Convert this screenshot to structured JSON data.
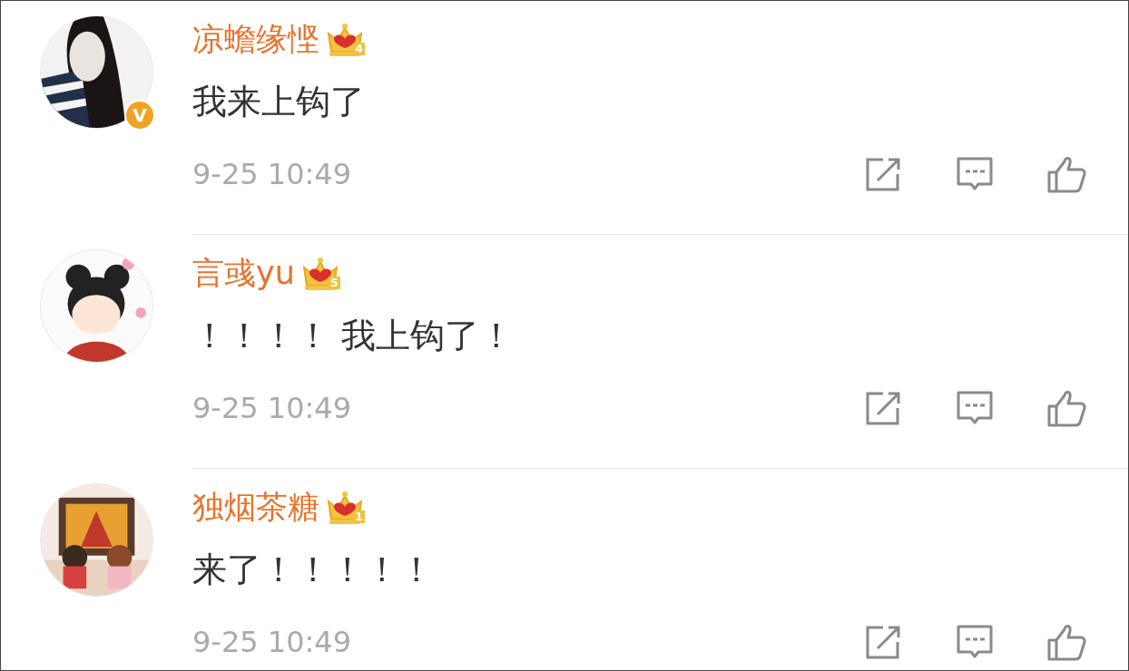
{
  "comments": [
    {
      "user": "凉蟾缘悭",
      "level_badge": "4",
      "verified": true,
      "verified_badge": "V",
      "text": "我来上钩了",
      "time": "9-25 10:49"
    },
    {
      "user": "言彧yu",
      "level_badge": "5",
      "verified": false,
      "text": "！！！！ 我上钩了！",
      "time": "9-25 10:49"
    },
    {
      "user": "独烟茶糖",
      "level_badge": "1",
      "verified": false,
      "text": "来了！！！！！",
      "time": "9-25 10:49"
    }
  ]
}
